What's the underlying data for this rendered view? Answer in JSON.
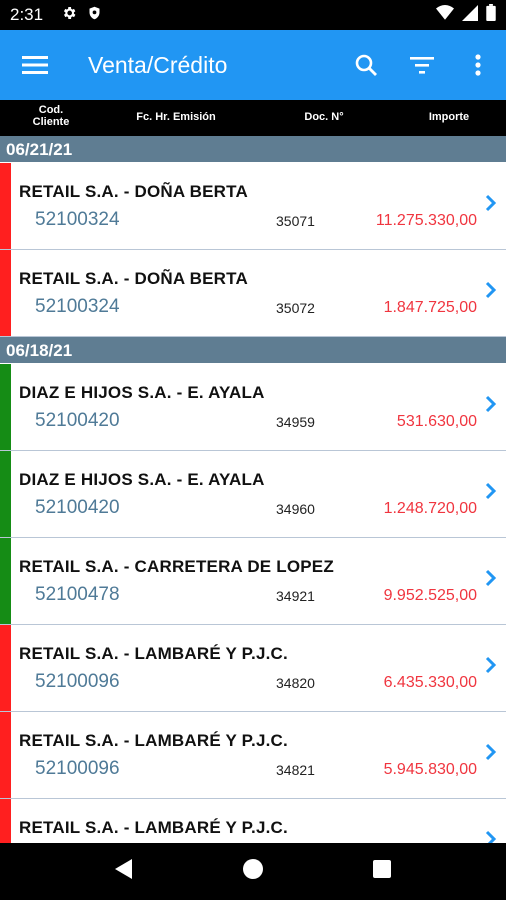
{
  "status_bar": {
    "time": "2:31"
  },
  "app_bar": {
    "title": "Venta/Crédito"
  },
  "columns": {
    "cod_cliente": "Cod.\nCliente",
    "fecha": "Fc. Hr. Emisión",
    "doc": "Doc. N°",
    "importe": "Importe"
  },
  "colors": {
    "accent": "#2196f3",
    "red": "#ff1f1f",
    "green": "#158c15",
    "amount": "#f0353f"
  },
  "groups": [
    {
      "date": "06/21/21",
      "rows": [
        {
          "client": "RETAIL S.A. - DOÑA BERTA",
          "code": "52100324",
          "doc": "35071",
          "amount": "11.275.330,00",
          "status": "red"
        },
        {
          "client": "RETAIL S.A. - DOÑA BERTA",
          "code": "52100324",
          "doc": "35072",
          "amount": "1.847.725,00",
          "status": "red"
        }
      ]
    },
    {
      "date": "06/18/21",
      "rows": [
        {
          "client": "DIAZ E HIJOS S.A. - E. AYALA",
          "code": "52100420",
          "doc": "34959",
          "amount": "531.630,00",
          "status": "green"
        },
        {
          "client": "DIAZ E HIJOS S.A. - E. AYALA",
          "code": "52100420",
          "doc": "34960",
          "amount": "1.248.720,00",
          "status": "green"
        },
        {
          "client": "RETAIL S.A. - CARRETERA DE LOPEZ",
          "code": "52100478",
          "doc": "34921",
          "amount": "9.952.525,00",
          "status": "green"
        },
        {
          "client": "RETAIL S.A. - LAMBARÉ Y P.J.C.",
          "code": "52100096",
          "doc": "34820",
          "amount": "6.435.330,00",
          "status": "red"
        },
        {
          "client": "RETAIL S.A. - LAMBARÉ Y P.J.C.",
          "code": "52100096",
          "doc": "34821",
          "amount": "5.945.830,00",
          "status": "red"
        },
        {
          "client": "RETAIL S.A. - LAMBARÉ Y P.J.C.",
          "code": "",
          "doc": "",
          "amount": "",
          "status": "red"
        }
      ]
    }
  ]
}
